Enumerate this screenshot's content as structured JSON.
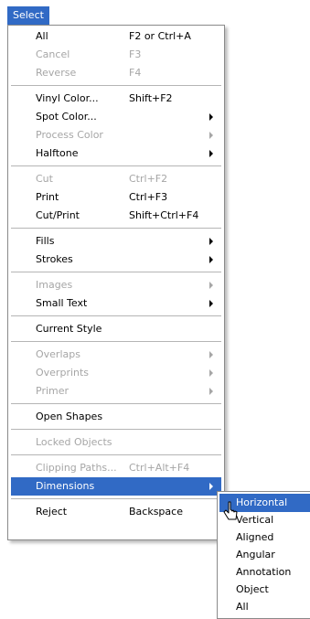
{
  "menubar": {
    "title": "Select"
  },
  "menu": {
    "items": [
      {
        "label": "All",
        "shortcut": "F2 or Ctrl+A"
      },
      {
        "label": "Cancel",
        "shortcut": "F3"
      },
      {
        "label": "Reverse",
        "shortcut": "F4"
      },
      {
        "label": "Vinyl Color...",
        "shortcut": "Shift+F2"
      },
      {
        "label": "Spot Color..."
      },
      {
        "label": "Process Color"
      },
      {
        "label": "Halftone"
      },
      {
        "label": "Cut",
        "shortcut": "Ctrl+F2"
      },
      {
        "label": "Print",
        "shortcut": "Ctrl+F3"
      },
      {
        "label": "Cut/Print",
        "shortcut": "Shift+Ctrl+F4"
      },
      {
        "label": "Fills"
      },
      {
        "label": "Strokes"
      },
      {
        "label": "Images"
      },
      {
        "label": "Small Text"
      },
      {
        "label": "Current Style"
      },
      {
        "label": "Overlaps"
      },
      {
        "label": "Overprints"
      },
      {
        "label": "Primer"
      },
      {
        "label": "Open Shapes"
      },
      {
        "label": "Locked Objects"
      },
      {
        "label": "Clipping Paths...",
        "shortcut": "Ctrl+Alt+F4"
      },
      {
        "label": "Dimensions"
      },
      {
        "label": "Reject",
        "shortcut": "Backspace"
      }
    ]
  },
  "submenu": {
    "items": [
      "Horizontal",
      "Vertical",
      "Aligned",
      "Angular",
      "Annotation",
      "Object",
      "All"
    ]
  },
  "colors": {
    "highlight": "#316ac5",
    "disabled_text": "#a6a6a6"
  }
}
